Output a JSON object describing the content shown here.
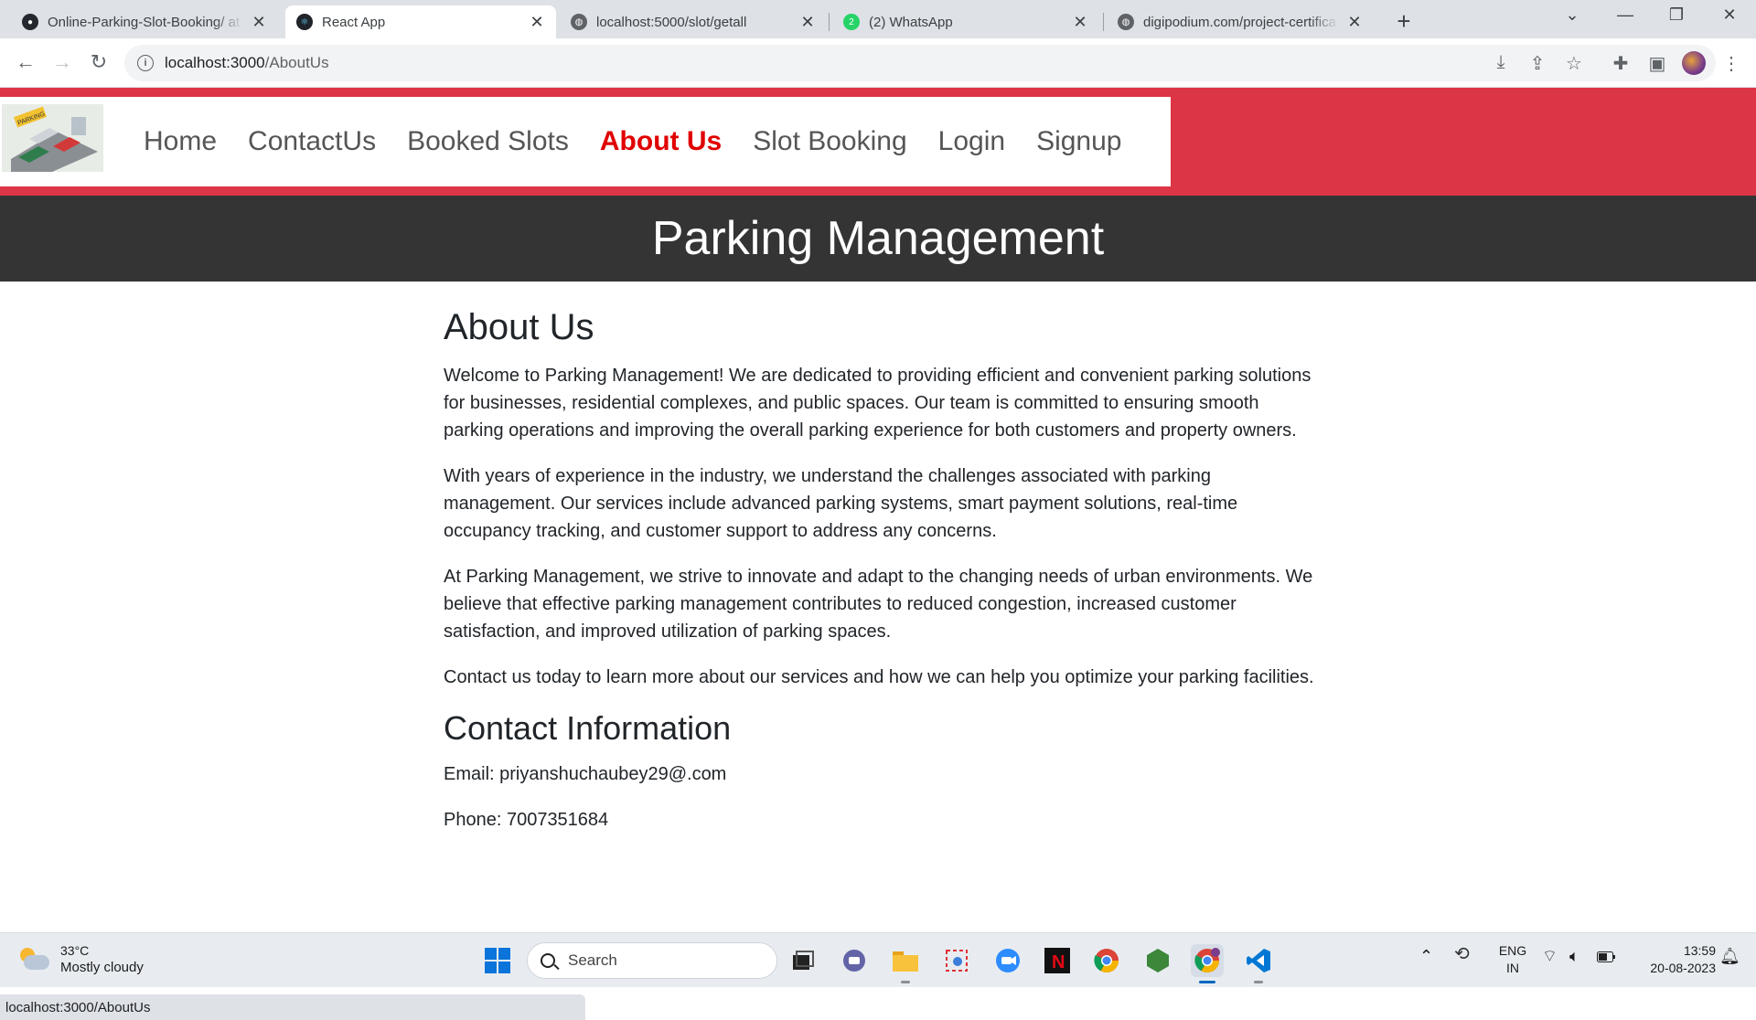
{
  "browser": {
    "tabs": [
      {
        "title": "Online-Parking-Slot-Booking/ at",
        "icon": "github-icon",
        "active": false
      },
      {
        "title": "React App",
        "icon": "react-icon",
        "active": true
      },
      {
        "title": "localhost:5000/slot/getall",
        "icon": "globe-icon",
        "active": false
      },
      {
        "title": "(2) WhatsApp",
        "icon": "whatsapp-icon",
        "badge": "2",
        "active": false
      },
      {
        "title": "digipodium.com/project-certifica",
        "icon": "globe-icon",
        "active": false
      }
    ],
    "url_host": "localhost:3000",
    "url_path": "/AboutUs"
  },
  "navbar": {
    "logo_text": "PARKING",
    "links": [
      "Home",
      "ContactUs",
      "Booked Slots",
      "About Us",
      "Slot Booking",
      "Login",
      "Signup"
    ],
    "active_link": "About Us"
  },
  "hero": {
    "title": "Parking Management"
  },
  "about": {
    "heading": "About Us",
    "paragraphs": [
      "Welcome to Parking Management! We are dedicated to providing efficient and convenient parking solutions for businesses, residential complexes, and public spaces. Our team is committed to ensuring smooth parking operations and improving the overall parking experience for both customers and property owners.",
      "With years of experience in the industry, we understand the challenges associated with parking management. Our services include advanced parking systems, smart payment solutions, real-time occupancy tracking, and customer support to address any concerns.",
      "At Parking Management, we strive to innovate and adapt to the changing needs of urban environments. We believe that effective parking management contributes to reduced congestion, increased customer satisfaction, and improved utilization of parking spaces.",
      "Contact us today to learn more about our services and how we can help you optimize your parking facilities."
    ]
  },
  "contact": {
    "heading": "Contact Information",
    "email": "Email: priyanshuchaubey29@.com",
    "phone": "Phone: 7007351684"
  },
  "status_url": "localhost:3000/AboutUs",
  "taskbar": {
    "weather_temp": "33°C",
    "weather_desc": "Mostly cloudy",
    "search_placeholder": "Search",
    "lang_top": "ENG",
    "lang_bottom": "IN",
    "time": "13:59",
    "date": "20-08-2023"
  },
  "colors": {
    "accent_red": "#dc3545",
    "active_link": "#e00000",
    "hero_bg": "#343434"
  }
}
